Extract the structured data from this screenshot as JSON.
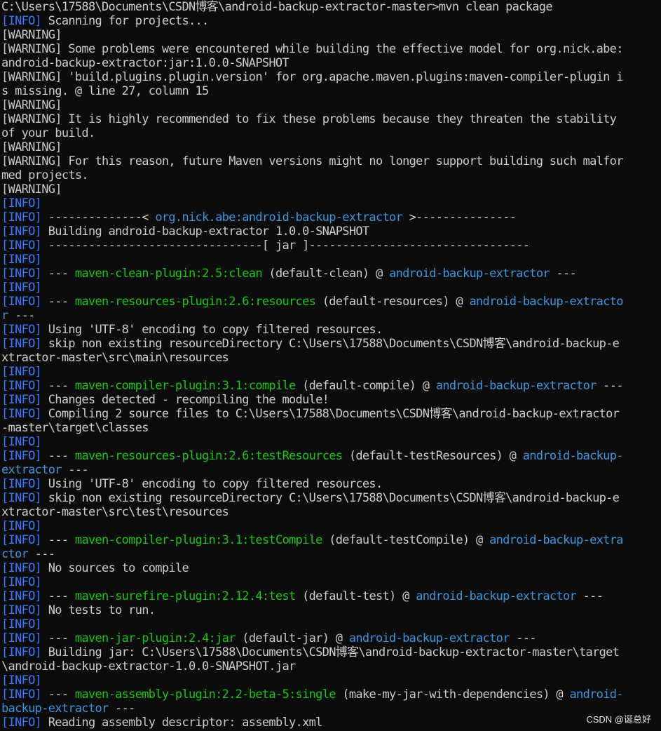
{
  "terminal": {
    "info_tag": "[INFO]",
    "warning_tag": "[WARNING]",
    "lines": [
      {
        "segs": [
          {
            "t": "C:\\Users\\17588\\Documents\\CSDN博客\\android-backup-extractor-master>mvn clean package",
            "c": "plain"
          }
        ]
      },
      {
        "segs": [
          {
            "t": "[INFO]",
            "c": "info"
          },
          {
            "t": " Scanning for projects...",
            "c": "plain"
          }
        ]
      },
      {
        "segs": [
          {
            "t": "[WARNING]",
            "c": "warn"
          }
        ]
      },
      {
        "segs": [
          {
            "t": "[WARNING]",
            "c": "warn"
          },
          {
            "t": " Some problems were encountered while building the effective model for org.nick.abe:",
            "c": "plain"
          }
        ]
      },
      {
        "segs": [
          {
            "t": "android-backup-extractor:jar:1.0.0-SNAPSHOT",
            "c": "plain"
          }
        ]
      },
      {
        "segs": [
          {
            "t": "[WARNING]",
            "c": "warn"
          },
          {
            "t": " 'build.plugins.plugin.version' for org.apache.maven.plugins:maven-compiler-plugin i",
            "c": "plain"
          }
        ]
      },
      {
        "segs": [
          {
            "t": "s missing. @ line 27, column 15",
            "c": "plain"
          }
        ]
      },
      {
        "segs": [
          {
            "t": "[WARNING]",
            "c": "warn"
          }
        ]
      },
      {
        "segs": [
          {
            "t": "[WARNING]",
            "c": "warn"
          },
          {
            "t": " It is highly recommended to fix these problems because they threaten the stability",
            "c": "plain"
          }
        ]
      },
      {
        "segs": [
          {
            "t": "of your build.",
            "c": "plain"
          }
        ]
      },
      {
        "segs": [
          {
            "t": "[WARNING]",
            "c": "warn"
          }
        ]
      },
      {
        "segs": [
          {
            "t": "[WARNING]",
            "c": "warn"
          },
          {
            "t": " For this reason, future Maven versions might no longer support building such malfor",
            "c": "plain"
          }
        ]
      },
      {
        "segs": [
          {
            "t": "med projects.",
            "c": "plain"
          }
        ]
      },
      {
        "segs": [
          {
            "t": "[WARNING]",
            "c": "warn"
          }
        ]
      },
      {
        "segs": [
          {
            "t": "[INFO]",
            "c": "info"
          }
        ]
      },
      {
        "segs": [
          {
            "t": "[INFO]",
            "c": "info"
          },
          {
            "t": " --------------< ",
            "c": "plain"
          },
          {
            "t": "org.nick.abe:android-backup-extractor",
            "c": "cyan"
          },
          {
            "t": " >---------------",
            "c": "plain"
          }
        ]
      },
      {
        "segs": [
          {
            "t": "[INFO]",
            "c": "info"
          },
          {
            "t": " Building android-backup-extractor 1.0.0-SNAPSHOT",
            "c": "plain"
          }
        ]
      },
      {
        "segs": [
          {
            "t": "[INFO]",
            "c": "info"
          },
          {
            "t": " --------------------------------[ jar ]---------------------------------",
            "c": "plain"
          }
        ]
      },
      {
        "segs": [
          {
            "t": "[INFO]",
            "c": "info"
          }
        ]
      },
      {
        "segs": [
          {
            "t": "[INFO]",
            "c": "info"
          },
          {
            "t": " --- ",
            "c": "plain"
          },
          {
            "t": "maven-clean-plugin:2.5:clean",
            "c": "green"
          },
          {
            "t": " (default-clean) @ ",
            "c": "plain"
          },
          {
            "t": "android-backup-extractor",
            "c": "cyan"
          },
          {
            "t": " ---",
            "c": "plain"
          }
        ]
      },
      {
        "segs": [
          {
            "t": "[INFO]",
            "c": "info"
          }
        ]
      },
      {
        "segs": [
          {
            "t": "[INFO]",
            "c": "info"
          },
          {
            "t": " --- ",
            "c": "plain"
          },
          {
            "t": "maven-resources-plugin:2.6:resources",
            "c": "green"
          },
          {
            "t": " (default-resources) @ ",
            "c": "plain"
          },
          {
            "t": "android-backup-extracto",
            "c": "cyan"
          }
        ]
      },
      {
        "segs": [
          {
            "t": "r",
            "c": "cyan"
          },
          {
            "t": " ---",
            "c": "plain"
          }
        ]
      },
      {
        "segs": [
          {
            "t": "[INFO]",
            "c": "info"
          },
          {
            "t": " Using 'UTF-8' encoding to copy filtered resources.",
            "c": "plain"
          }
        ]
      },
      {
        "segs": [
          {
            "t": "[INFO]",
            "c": "info"
          },
          {
            "t": " skip non existing resourceDirectory C:\\Users\\17588\\Documents\\CSDN博客\\android-backup-e",
            "c": "plain"
          }
        ]
      },
      {
        "segs": [
          {
            "t": "xtractor-master\\src\\main\\resources",
            "c": "plain"
          }
        ]
      },
      {
        "segs": [
          {
            "t": "[INFO]",
            "c": "info"
          }
        ]
      },
      {
        "segs": [
          {
            "t": "[INFO]",
            "c": "info"
          },
          {
            "t": " --- ",
            "c": "plain"
          },
          {
            "t": "maven-compiler-plugin:3.1:compile",
            "c": "green"
          },
          {
            "t": " (default-compile) @ ",
            "c": "plain"
          },
          {
            "t": "android-backup-extractor",
            "c": "cyan"
          },
          {
            "t": " ---",
            "c": "plain"
          }
        ]
      },
      {
        "segs": [
          {
            "t": "[INFO]",
            "c": "info"
          },
          {
            "t": " Changes detected - recompiling the module!",
            "c": "plain"
          }
        ]
      },
      {
        "segs": [
          {
            "t": "[INFO]",
            "c": "info"
          },
          {
            "t": " Compiling 2 source files to C:\\Users\\17588\\Documents\\CSDN博客\\android-backup-extractor",
            "c": "plain"
          }
        ]
      },
      {
        "segs": [
          {
            "t": "-master\\target\\classes",
            "c": "plain"
          }
        ]
      },
      {
        "segs": [
          {
            "t": "[INFO]",
            "c": "info"
          }
        ]
      },
      {
        "segs": [
          {
            "t": "[INFO]",
            "c": "info"
          },
          {
            "t": " --- ",
            "c": "plain"
          },
          {
            "t": "maven-resources-plugin:2.6:testResources",
            "c": "green"
          },
          {
            "t": " (default-testResources) @ ",
            "c": "plain"
          },
          {
            "t": "android-backup-",
            "c": "cyan"
          }
        ]
      },
      {
        "segs": [
          {
            "t": "extractor",
            "c": "cyan"
          },
          {
            "t": " ---",
            "c": "plain"
          }
        ]
      },
      {
        "segs": [
          {
            "t": "[INFO]",
            "c": "info"
          },
          {
            "t": " Using 'UTF-8' encoding to copy filtered resources.",
            "c": "plain"
          }
        ]
      },
      {
        "segs": [
          {
            "t": "[INFO]",
            "c": "info"
          },
          {
            "t": " skip non existing resourceDirectory C:\\Users\\17588\\Documents\\CSDN博客\\android-backup-e",
            "c": "plain"
          }
        ]
      },
      {
        "segs": [
          {
            "t": "xtractor-master\\src\\test\\resources",
            "c": "plain"
          }
        ]
      },
      {
        "segs": [
          {
            "t": "[INFO]",
            "c": "info"
          }
        ]
      },
      {
        "segs": [
          {
            "t": "[INFO]",
            "c": "info"
          },
          {
            "t": " --- ",
            "c": "plain"
          },
          {
            "t": "maven-compiler-plugin:3.1:testCompile",
            "c": "green"
          },
          {
            "t": " (default-testCompile) @ ",
            "c": "plain"
          },
          {
            "t": "android-backup-extra",
            "c": "cyan"
          }
        ]
      },
      {
        "segs": [
          {
            "t": "ctor",
            "c": "cyan"
          },
          {
            "t": " ---",
            "c": "plain"
          }
        ]
      },
      {
        "segs": [
          {
            "t": "[INFO]",
            "c": "info"
          },
          {
            "t": " No sources to compile",
            "c": "plain"
          }
        ]
      },
      {
        "segs": [
          {
            "t": "[INFO]",
            "c": "info"
          }
        ]
      },
      {
        "segs": [
          {
            "t": "[INFO]",
            "c": "info"
          },
          {
            "t": " --- ",
            "c": "plain"
          },
          {
            "t": "maven-surefire-plugin:2.12.4:test",
            "c": "green"
          },
          {
            "t": " (default-test) @ ",
            "c": "plain"
          },
          {
            "t": "android-backup-extractor",
            "c": "cyan"
          },
          {
            "t": " ---",
            "c": "plain"
          }
        ]
      },
      {
        "segs": [
          {
            "t": "[INFO]",
            "c": "info"
          },
          {
            "t": " No tests to run.",
            "c": "plain"
          }
        ]
      },
      {
        "segs": [
          {
            "t": "[INFO]",
            "c": "info"
          }
        ]
      },
      {
        "segs": [
          {
            "t": "[INFO]",
            "c": "info"
          },
          {
            "t": " --- ",
            "c": "plain"
          },
          {
            "t": "maven-jar-plugin:2.4:jar",
            "c": "green"
          },
          {
            "t": " (default-jar) @ ",
            "c": "plain"
          },
          {
            "t": "android-backup-extractor",
            "c": "cyan"
          },
          {
            "t": " ---",
            "c": "plain"
          }
        ]
      },
      {
        "segs": [
          {
            "t": "[INFO]",
            "c": "info"
          },
          {
            "t": " Building jar: C:\\Users\\17588\\Documents\\CSDN博客\\android-backup-extractor-master\\target",
            "c": "plain"
          }
        ]
      },
      {
        "segs": [
          {
            "t": "\\android-backup-extractor-1.0.0-SNAPSHOT.jar",
            "c": "plain"
          }
        ]
      },
      {
        "segs": [
          {
            "t": "[INFO]",
            "c": "info"
          }
        ]
      },
      {
        "segs": [
          {
            "t": "[INFO]",
            "c": "info"
          },
          {
            "t": " --- ",
            "c": "plain"
          },
          {
            "t": "maven-assembly-plugin:2.2-beta-5:single",
            "c": "green"
          },
          {
            "t": " (make-my-jar-with-dependencies) @ ",
            "c": "plain"
          },
          {
            "t": "android-",
            "c": "cyan"
          }
        ]
      },
      {
        "segs": [
          {
            "t": "backup-extractor",
            "c": "cyan"
          },
          {
            "t": " ---",
            "c": "plain"
          }
        ]
      },
      {
        "segs": [
          {
            "t": "[INFO]",
            "c": "info"
          },
          {
            "t": " Reading assembly descriptor: assembly.xml",
            "c": "plain"
          }
        ]
      }
    ]
  },
  "watermark": "CSDN @诞总好",
  "colors": {
    "background": "#0c0c0c",
    "text": "#cccccc",
    "info_tag": "#3b78ff",
    "plugin_green": "#16c60c",
    "artifact_cyan": "#3a96dd"
  }
}
